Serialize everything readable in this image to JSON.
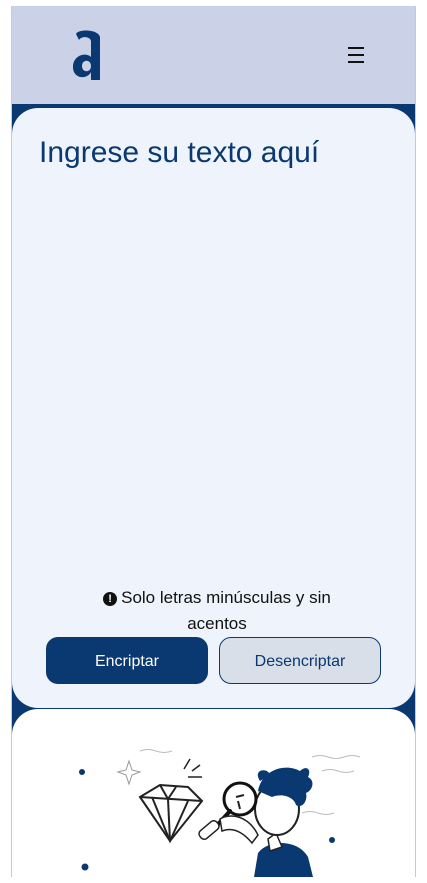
{
  "header": {
    "logo_icon": "alura-a-logo",
    "menu_icon": "hamburger-menu-icon"
  },
  "input": {
    "placeholder": "Ingrese su texto aquí",
    "value": ""
  },
  "warning": {
    "icon": "exclamation-circle-icon",
    "text": "Solo letras minúsculas y sin acentos"
  },
  "actions": {
    "encrypt_label": "Encriptar",
    "decrypt_label": "Desencriptar"
  },
  "output": {
    "illustration": "person-with-magnifying-glass-and-diamond"
  },
  "colors": {
    "primary": "#0a3871",
    "header_bg": "#cbd1e6",
    "card_bg": "#eff3fb",
    "secondary_button_bg": "#d8dfe8"
  }
}
